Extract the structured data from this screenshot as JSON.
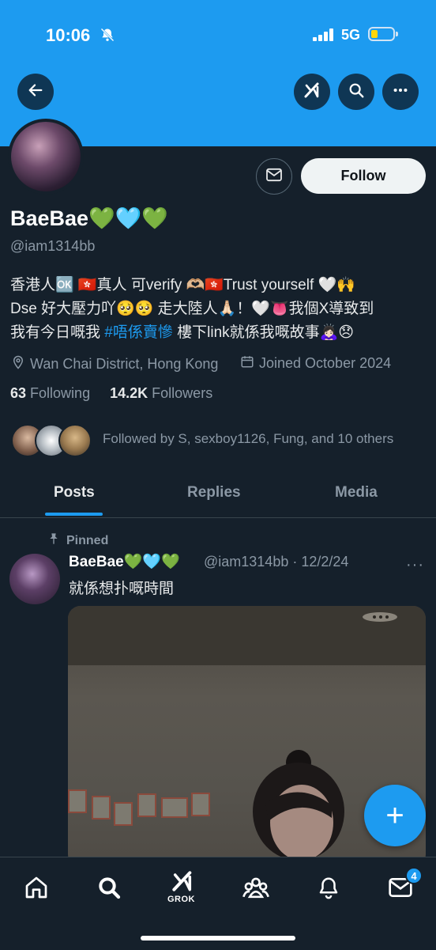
{
  "status_bar": {
    "time": "10:06",
    "network": "5G",
    "battery_level": 0.3
  },
  "header": {
    "back_icon": "arrow-left-icon",
    "grok_icon": "grok-icon",
    "search_icon": "search-icon",
    "more_icon": "more-horizontal-icon"
  },
  "profile": {
    "name": "BaeBae💚🩵💚",
    "handle": "@iam1314bb",
    "follow_label": "Follow",
    "bio_line1": "香港人🆗 🇭🇰真人 可verify 🫶🏼🇭🇰Trust yourself 🤍🙌",
    "bio_line2": "Dse 好大壓力吖🥺🥺 走大陸人🙏🏻！🤍👅我個X導致到",
    "bio_line3_pre": "我有今日嘅我 ",
    "bio_hashtag": "#唔係賣慘",
    "bio_line3_post": " 樓下link就係我嘅故事🙇🏻‍♀️😞",
    "location": "Wan Chai District, Hong Kong",
    "joined": "Joined October 2024",
    "following_count": "63",
    "following_label": "Following",
    "followers_count": "14.2K",
    "followers_label": "Followers",
    "followed_by": "Followed by S, sexboy1126, Fung, and 10 others"
  },
  "tabs": [
    {
      "label": "Posts",
      "active": true
    },
    {
      "label": "Replies",
      "active": false
    },
    {
      "label": "Media",
      "active": false
    }
  ],
  "post": {
    "pinned_label": "Pinned",
    "author_name": "BaeBae💚🩵💚",
    "author_handle": "@iam1314bb · 12/2/24",
    "more": "···",
    "text": "就係想扑嘅時間"
  },
  "fab": {
    "icon": "plus-icon",
    "label": "+"
  },
  "bottom_nav": {
    "items": [
      "home-icon",
      "search-icon",
      "grok-icon",
      "communities-icon",
      "notifications-icon",
      "messages-icon"
    ],
    "grok_label": "GROK",
    "messages_badge": "4"
  },
  "colors": {
    "accent": "#1d9bf0",
    "background": "#15202b",
    "muted": "#8b98a5"
  }
}
